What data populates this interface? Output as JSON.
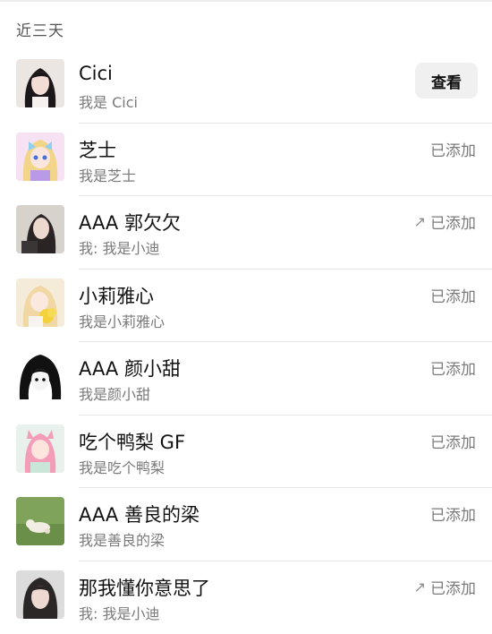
{
  "section_title": "近三天",
  "contacts": [
    {
      "name": "Cici",
      "desc": "我是 Cici",
      "status": "",
      "action": "查看",
      "arrow": false
    },
    {
      "name": "芝士",
      "desc": "我是芝士",
      "status": "已添加",
      "arrow": false
    },
    {
      "name": "AAA 郭欠欠",
      "desc": "我: 我是小迪",
      "status": "已添加",
      "arrow": true
    },
    {
      "name": "小莉雅心",
      "desc": "我是小莉雅心",
      "status": "已添加",
      "arrow": false
    },
    {
      "name": "AAA 颜小甜",
      "desc": "我是颜小甜",
      "status": "已添加",
      "arrow": false
    },
    {
      "name": "吃个鸭梨 GF",
      "desc": "我是吃个鸭梨",
      "status": "已添加",
      "arrow": false
    },
    {
      "name": "AAA 善良的梁",
      "desc": "我是善良的梁",
      "status": "已添加",
      "arrow": false
    },
    {
      "name": "那我懂你意思了",
      "desc": "我: 我是小迪",
      "status": "已添加",
      "arrow": true
    }
  ]
}
